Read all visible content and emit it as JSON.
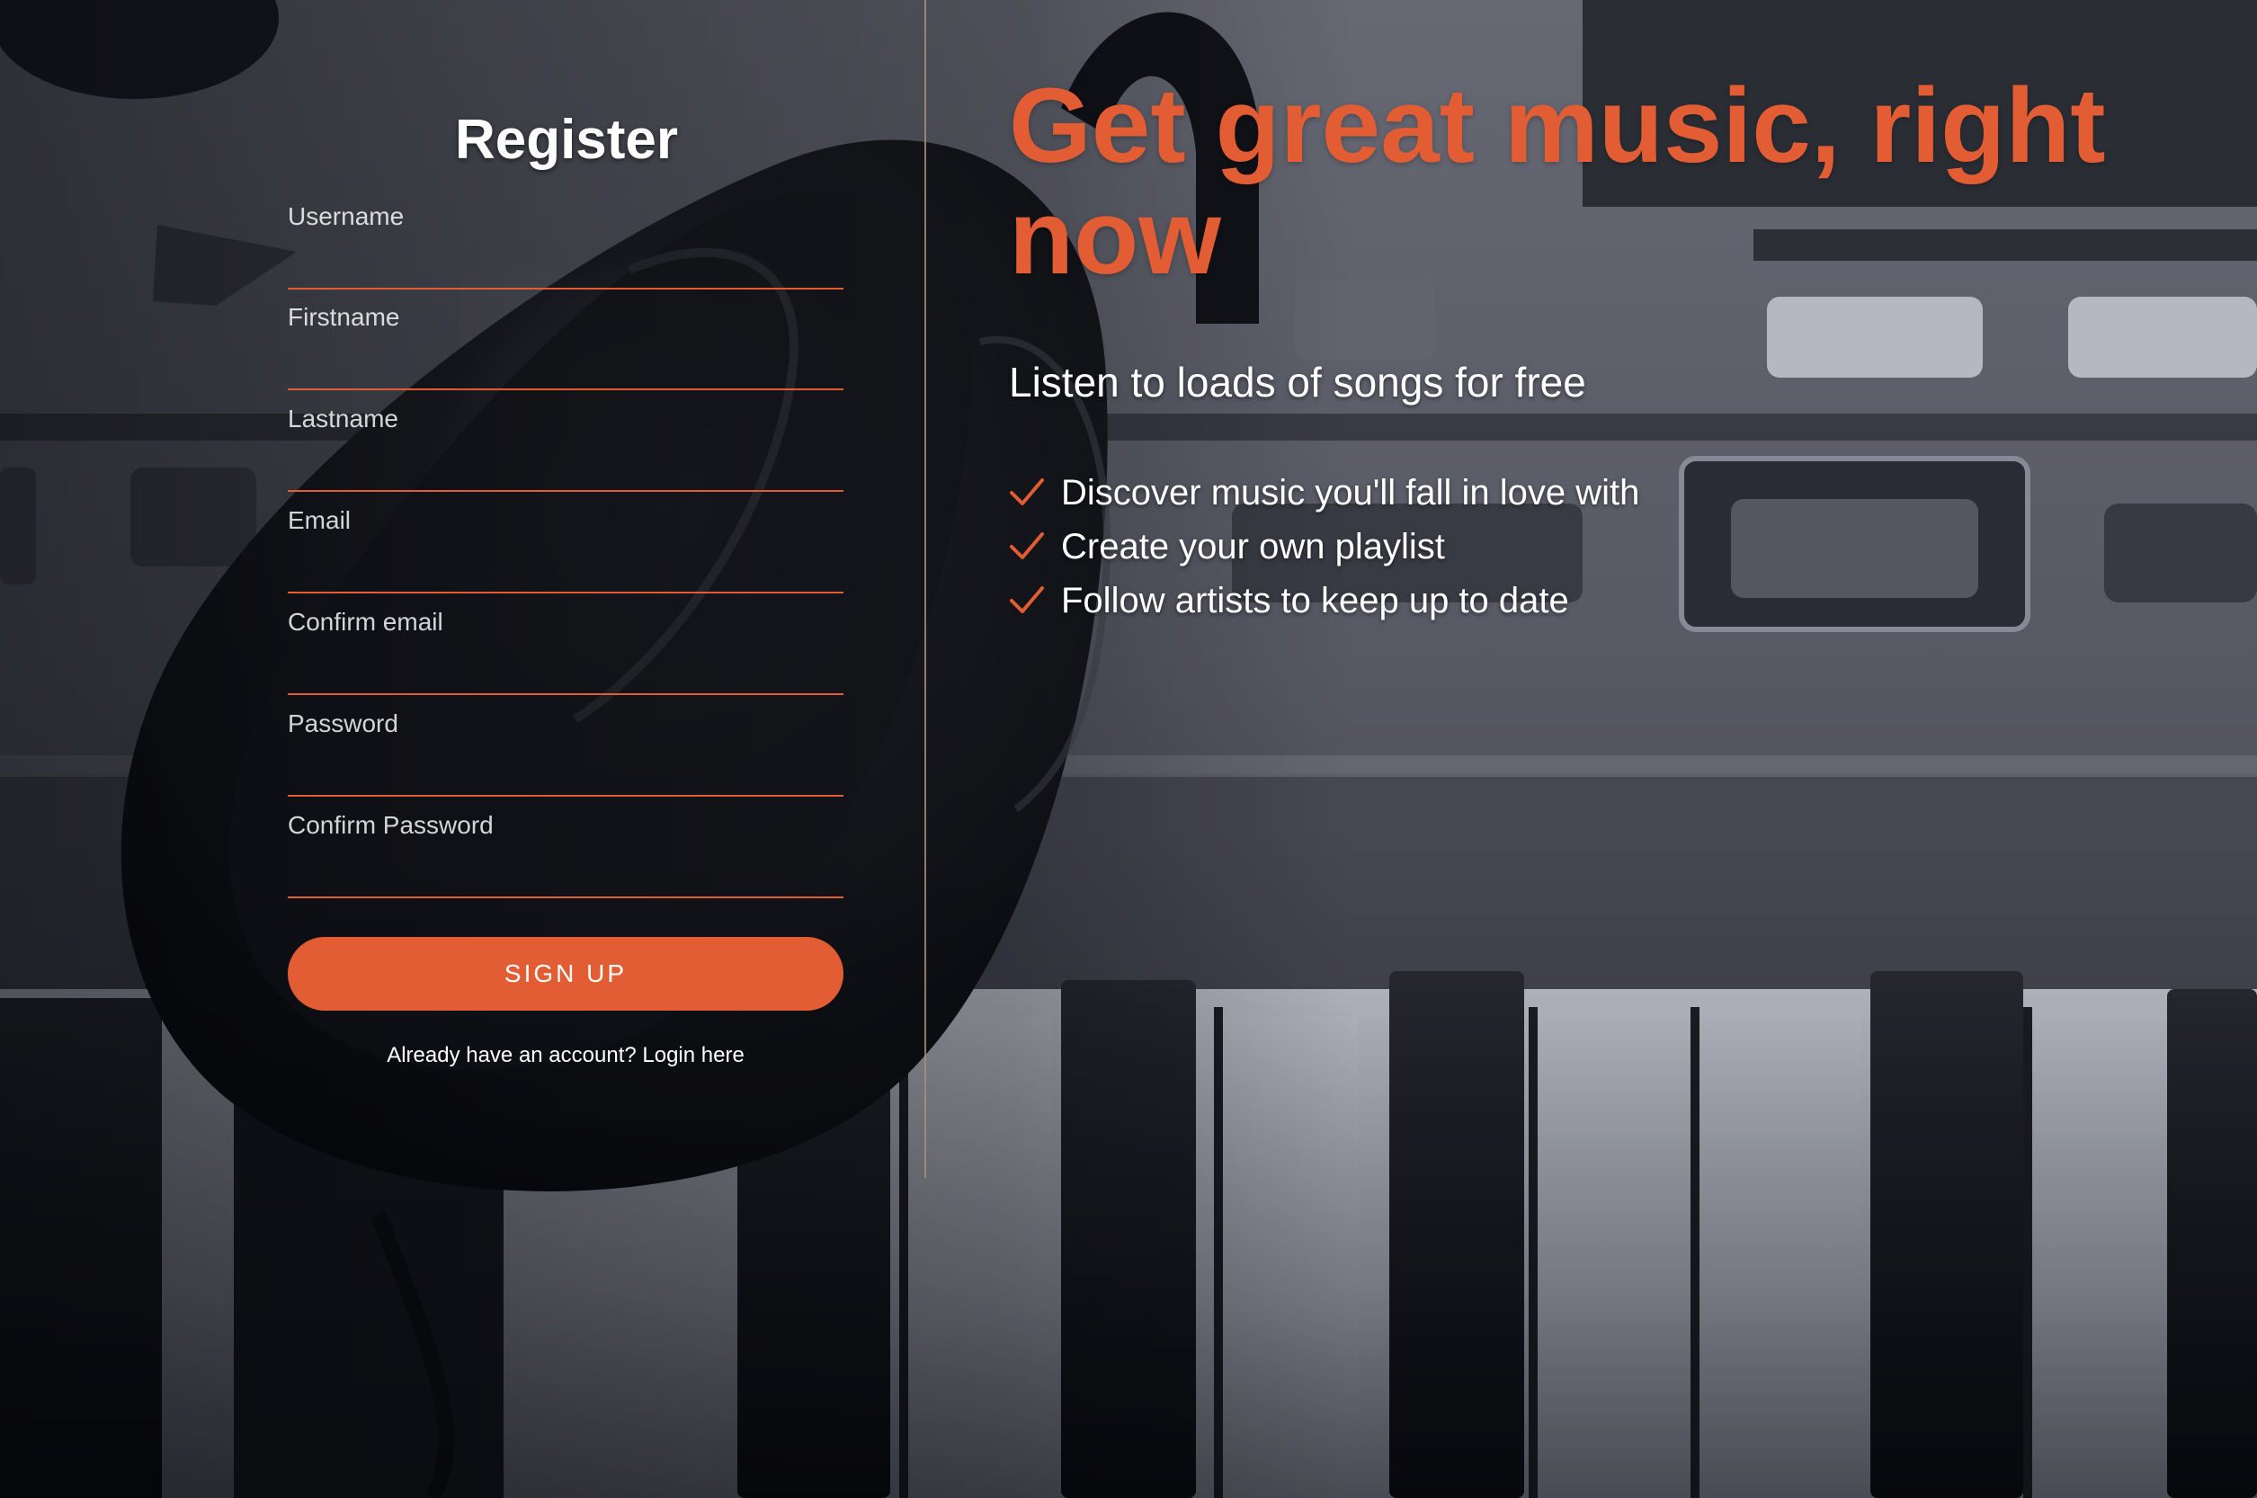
{
  "register": {
    "title": "Register",
    "fields": [
      {
        "placeholder": "Username"
      },
      {
        "placeholder": "Firstname"
      },
      {
        "placeholder": "Lastname"
      },
      {
        "placeholder": "Email"
      },
      {
        "placeholder": "Confirm email"
      },
      {
        "placeholder": "Password"
      },
      {
        "placeholder": "Confirm Password"
      }
    ],
    "signup_label": "SIGN UP",
    "login_prompt": "Already have an account? Login here"
  },
  "hero": {
    "headline": "Get great music, right now",
    "subtitle": "Listen to loads of songs for free",
    "features": [
      "Discover music you'll fall in love with",
      "Create your own playlist",
      "Follow artists to keep up to date"
    ]
  },
  "colors": {
    "accent": "#e25d33",
    "text": "#ffffff"
  },
  "icons": {
    "feature_check": "checkmark-icon"
  }
}
